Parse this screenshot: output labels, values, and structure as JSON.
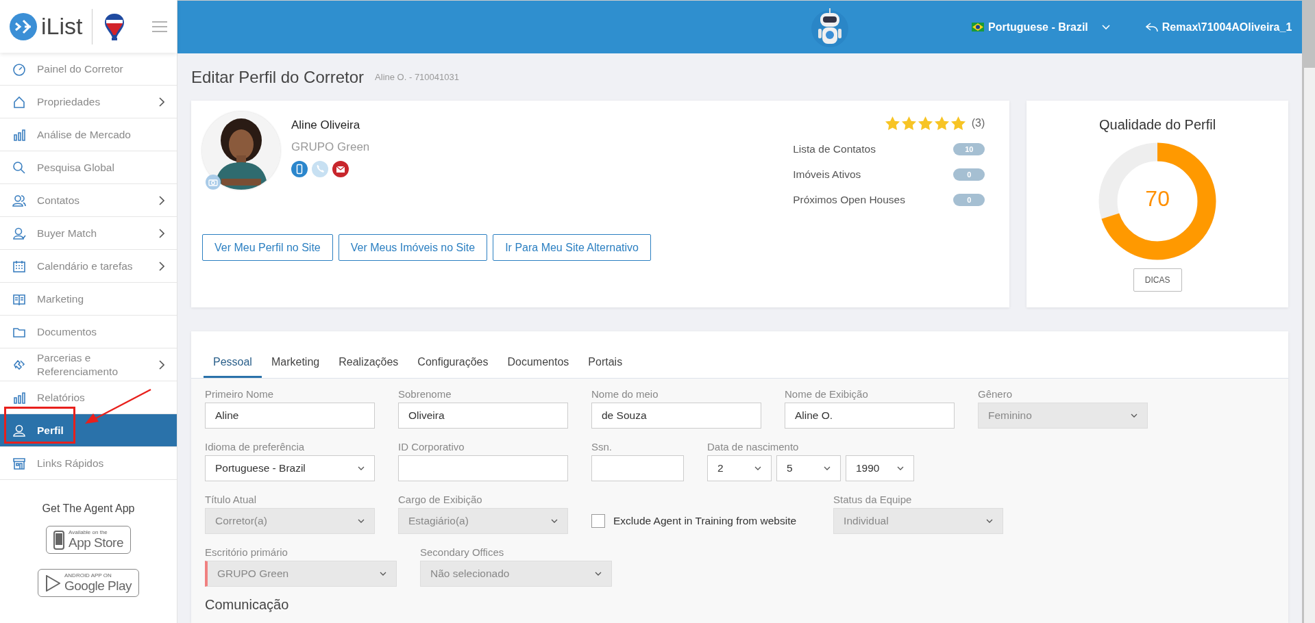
{
  "sidebar": {
    "brand": "iList",
    "items": [
      {
        "label": "Painel do Corretor",
        "has_submenu": false,
        "selected": false
      },
      {
        "label": "Propriedades",
        "has_submenu": true,
        "selected": false
      },
      {
        "label": "Análise de Mercado",
        "has_submenu": false,
        "selected": false
      },
      {
        "label": "Pesquisa Global",
        "has_submenu": false,
        "selected": false
      },
      {
        "label": "Contatos",
        "has_submenu": true,
        "selected": false
      },
      {
        "label": "Buyer Match",
        "has_submenu": true,
        "selected": false
      },
      {
        "label": "Calendário e tarefas",
        "has_submenu": true,
        "selected": false
      },
      {
        "label": "Marketing",
        "has_submenu": false,
        "selected": false
      },
      {
        "label": "Documentos",
        "has_submenu": false,
        "selected": false
      },
      {
        "label": "Parcerias e Referenciamento",
        "has_submenu": true,
        "selected": false
      },
      {
        "label": "Relatórios",
        "has_submenu": false,
        "selected": false
      },
      {
        "label": "Perfil",
        "has_submenu": false,
        "selected": true
      },
      {
        "label": "Links Rápidos",
        "has_submenu": false,
        "selected": false
      }
    ],
    "app_heading": "Get The Agent App",
    "app_badges": [
      {
        "kind": "apple",
        "small": "Available on the",
        "big": "App Store"
      },
      {
        "kind": "google",
        "small": "ANDROID APP ON",
        "big": "Google Play"
      }
    ]
  },
  "header": {
    "language": "Portuguese - Brazil",
    "user": "Remax\\71004AOliveira_1"
  },
  "page": {
    "title": "Editar Perfil do Corretor",
    "subtitle": "Aline O. - 710041031"
  },
  "profile": {
    "photo": {
      "kind": "picture"
    },
    "name": "Aline Oliveira",
    "group": "GRUPO Green",
    "contacts": [
      {
        "kind": "mobile"
      },
      {
        "kind": "phone"
      },
      {
        "kind": "email"
      }
    ],
    "stars": 5,
    "reviews": "(3)",
    "stats": [
      {
        "label": "Lista de Contatos",
        "count": "10"
      },
      {
        "label": "Imóveis Ativos",
        "count": "0"
      },
      {
        "label": "Próximos Open Houses",
        "count": "0"
      }
    ],
    "buttons": [
      "Ver Meu Perfil no Site",
      "Ver Meus Imóveis no Site",
      "Ir Para Meu Site Alternativo"
    ]
  },
  "quality": {
    "title": "Qualidade do Perfil",
    "level": 0.7,
    "score": "70",
    "button": "DICAS"
  },
  "tabs": [
    {
      "label": "Pessoal",
      "selected": true
    },
    {
      "label": "Marketing",
      "selected": false
    },
    {
      "label": "Realizações",
      "selected": false
    },
    {
      "label": "Configurações",
      "selected": false
    },
    {
      "label": "Documentos",
      "selected": false
    },
    {
      "label": "Portais",
      "selected": false
    }
  ],
  "form_rows": [
    [
      {
        "kind": "text",
        "label": "Primeiro Nome",
        "value": "Aline",
        "disabled": false
      },
      {
        "kind": "text",
        "label": "Sobrenome",
        "value": "Oliveira",
        "disabled": false
      },
      {
        "kind": "text",
        "label": "Nome do meio",
        "value": "de Souza",
        "disabled": false
      },
      {
        "kind": "text",
        "label": "Nome de Exibição",
        "value": "Aline O.",
        "disabled": false
      },
      {
        "kind": "select",
        "label": "Gênero",
        "value": "Feminino",
        "disabled": true
      }
    ],
    [
      {
        "kind": "select",
        "label": "Idioma de preferência",
        "value": "Portuguese - Brazil",
        "disabled": false
      },
      {
        "kind": "text",
        "label": "ID Corporativo",
        "disabled": false
      },
      {
        "kind": "text",
        "label": "Ssn.",
        "disabled": false
      },
      {
        "kind": "date",
        "label": "Data de nascimento",
        "parts": [
          "2",
          "5",
          "1990"
        ],
        "disabled": false
      }
    ],
    [
      {
        "kind": "select",
        "label": "Título Atual",
        "value": "Corretor(a)",
        "disabled": true
      },
      {
        "kind": "select",
        "label": "Cargo de Exibição",
        "value": "Estagiário(a)",
        "disabled": true
      },
      {
        "kind": "checkbox",
        "label": "Exclude Agent in Training from website",
        "checked": false
      },
      {
        "kind": "select",
        "label": "Status da Equipe",
        "value": "Individual",
        "disabled": true
      }
    ],
    [
      {
        "kind": "select",
        "label": "Escritório primário",
        "value": "GRUPO Green",
        "disabled": true,
        "required": true
      },
      {
        "kind": "select",
        "label": "Secondary Offices",
        "value": "Não selecionado",
        "disabled": true
      }
    ]
  ],
  "section_heading": "Comunicação",
  "annotation": {
    "kind": "box-with-arrow"
  }
}
